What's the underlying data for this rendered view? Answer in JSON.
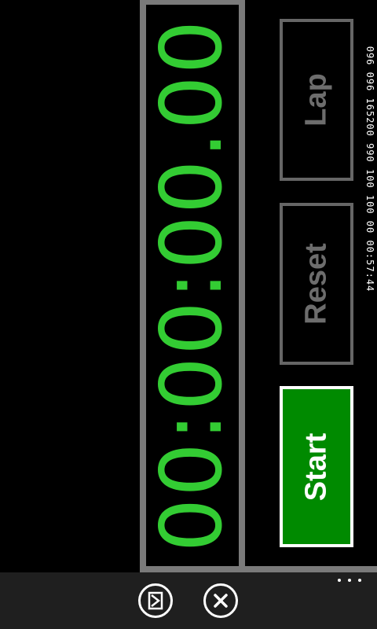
{
  "stopwatch": {
    "time": "00:00:00.00",
    "buttons": {
      "lap": "Lap",
      "reset": "Reset",
      "start": "Start"
    },
    "stats_line": "096 096 165200 990 100 100 00 00:57:44"
  },
  "app_bar": {
    "icons": [
      "mark-icon",
      "close-icon",
      "more-icon"
    ]
  },
  "colors": {
    "digits": "#33cc33",
    "start_bg": "#008a00",
    "frame": "#7a7a7a",
    "app_bar": "#1f1f1f"
  }
}
